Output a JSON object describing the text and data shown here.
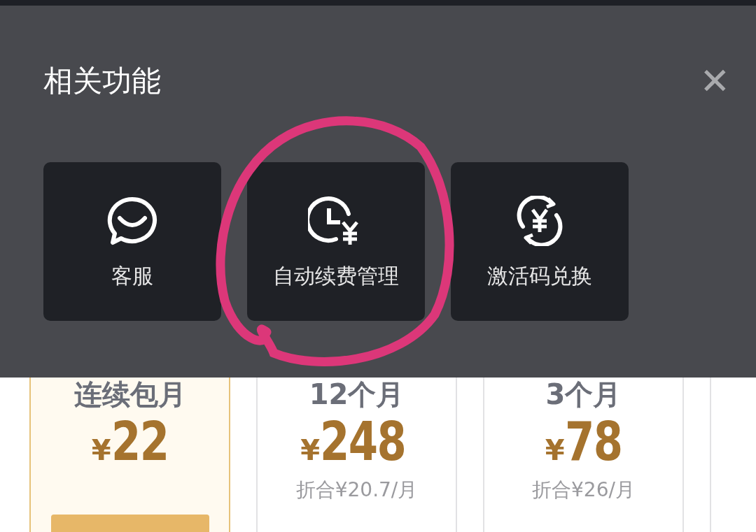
{
  "panel": {
    "title": "相关功能",
    "close": "✕",
    "tiles": [
      {
        "kind": "service",
        "label": "客服",
        "circled": false
      },
      {
        "kind": "renew",
        "label": "自动续费管理",
        "circled": true
      },
      {
        "kind": "redeem",
        "label": "激活码兑换",
        "circled": false
      }
    ]
  },
  "plans": [
    {
      "title": "连续包月",
      "currency": "¥",
      "price": "22",
      "selected": true,
      "tag": true
    },
    {
      "title": "12个月",
      "currency": "¥",
      "price": "248",
      "selected": false,
      "note": "折合¥20.7/月"
    },
    {
      "title": "3个月",
      "currency": "¥",
      "price": "78",
      "selected": false,
      "note": "折合¥26/月"
    }
  ]
}
